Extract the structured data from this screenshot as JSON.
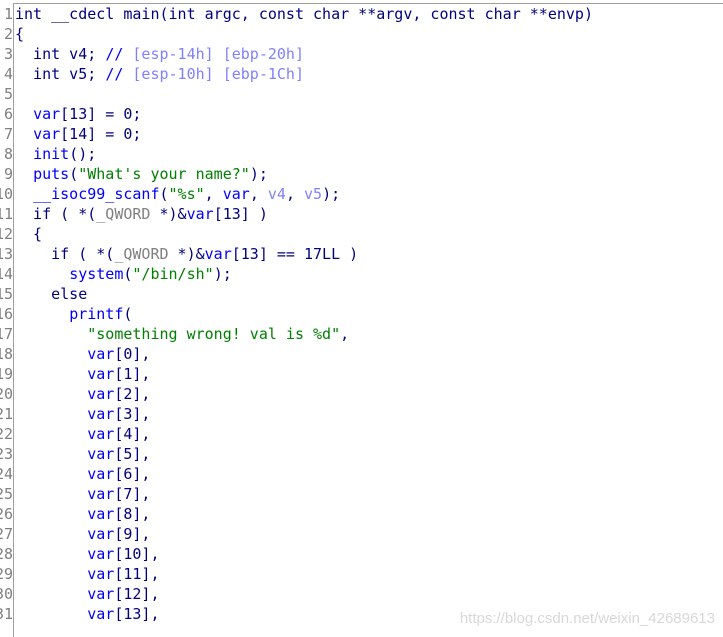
{
  "line_numbers": [
    "1",
    "2",
    "3",
    "4",
    "5",
    "6",
    "7",
    "8",
    "9",
    "10",
    "11",
    "12",
    "13",
    "14",
    "15",
    "16",
    "17",
    "18",
    "19",
    "20",
    "21",
    "22",
    "23",
    "24",
    "25",
    "26",
    "27",
    "28",
    "29",
    "30",
    "31"
  ],
  "lines": [
    [
      [
        "int __cdecl main(int argc, const char **argv, const char **envp)",
        "kw"
      ]
    ],
    [
      [
        "{",
        "kw"
      ]
    ],
    [
      [
        "  int v4; ",
        "kw"
      ],
      [
        "// ",
        "cm"
      ],
      [
        "[esp-14h] [ebp-20h]",
        "cv"
      ]
    ],
    [
      [
        "  int v5; ",
        "kw"
      ],
      [
        "// ",
        "cm"
      ],
      [
        "[esp-10h] [ebp-1Ch]",
        "cv"
      ]
    ],
    [],
    [
      [
        "  ",
        "kw"
      ],
      [
        "var",
        "id"
      ],
      [
        "[13] = 0;",
        "kw"
      ]
    ],
    [
      [
        "  ",
        "kw"
      ],
      [
        "var",
        "id"
      ],
      [
        "[14] = 0;",
        "kw"
      ]
    ],
    [
      [
        "  ",
        "kw"
      ],
      [
        "init",
        "id"
      ],
      [
        "();",
        "kw"
      ]
    ],
    [
      [
        "  ",
        "kw"
      ],
      [
        "puts",
        "id"
      ],
      [
        "(",
        "kw"
      ],
      [
        "\"What's your name?\"",
        "str"
      ],
      [
        ");",
        "kw"
      ]
    ],
    [
      [
        "  ",
        "kw"
      ],
      [
        "__isoc99_scanf",
        "id"
      ],
      [
        "(",
        "kw"
      ],
      [
        "\"%s\"",
        "str"
      ],
      [
        ", ",
        "kw"
      ],
      [
        "var",
        "id"
      ],
      [
        ", ",
        "kw"
      ],
      [
        "v4",
        "cv"
      ],
      [
        ", ",
        "kw"
      ],
      [
        "v5",
        "cv"
      ],
      [
        ");",
        "kw"
      ]
    ],
    [
      [
        "  if ( *(",
        "kw"
      ],
      [
        "_QWORD",
        "ty"
      ],
      [
        " *)&",
        "kw"
      ],
      [
        "var",
        "id"
      ],
      [
        "[13] )",
        "kw"
      ]
    ],
    [
      [
        "  {",
        "kw"
      ]
    ],
    [
      [
        "    if ( *(",
        "kw"
      ],
      [
        "_QWORD",
        "ty"
      ],
      [
        " *)&",
        "kw"
      ],
      [
        "var",
        "id"
      ],
      [
        "[13] == 17LL )",
        "kw"
      ]
    ],
    [
      [
        "      ",
        "kw"
      ],
      [
        "system",
        "id"
      ],
      [
        "(",
        "kw"
      ],
      [
        "\"/bin/sh\"",
        "str"
      ],
      [
        ");",
        "kw"
      ]
    ],
    [
      [
        "    else",
        "kw"
      ]
    ],
    [
      [
        "      ",
        "kw"
      ],
      [
        "printf",
        "id"
      ],
      [
        "(",
        "kw"
      ]
    ],
    [
      [
        "        ",
        "kw"
      ],
      [
        "\"something wrong! val is %d\"",
        "str"
      ],
      [
        ",",
        "kw"
      ]
    ],
    [
      [
        "        ",
        "kw"
      ],
      [
        "var",
        "id"
      ],
      [
        "[0],",
        "kw"
      ]
    ],
    [
      [
        "        ",
        "kw"
      ],
      [
        "var",
        "id"
      ],
      [
        "[1],",
        "kw"
      ]
    ],
    [
      [
        "        ",
        "kw"
      ],
      [
        "var",
        "id"
      ],
      [
        "[2],",
        "kw"
      ]
    ],
    [
      [
        "        ",
        "kw"
      ],
      [
        "var",
        "id"
      ],
      [
        "[3],",
        "kw"
      ]
    ],
    [
      [
        "        ",
        "kw"
      ],
      [
        "var",
        "id"
      ],
      [
        "[4],",
        "kw"
      ]
    ],
    [
      [
        "        ",
        "kw"
      ],
      [
        "var",
        "id"
      ],
      [
        "[5],",
        "kw"
      ]
    ],
    [
      [
        "        ",
        "kw"
      ],
      [
        "var",
        "id"
      ],
      [
        "[6],",
        "kw"
      ]
    ],
    [
      [
        "        ",
        "kw"
      ],
      [
        "var",
        "id"
      ],
      [
        "[7],",
        "kw"
      ]
    ],
    [
      [
        "        ",
        "kw"
      ],
      [
        "var",
        "id"
      ],
      [
        "[8],",
        "kw"
      ]
    ],
    [
      [
        "        ",
        "kw"
      ],
      [
        "var",
        "id"
      ],
      [
        "[9],",
        "kw"
      ]
    ],
    [
      [
        "        ",
        "kw"
      ],
      [
        "var",
        "id"
      ],
      [
        "[10],",
        "kw"
      ]
    ],
    [
      [
        "        ",
        "kw"
      ],
      [
        "var",
        "id"
      ],
      [
        "[11],",
        "kw"
      ]
    ],
    [
      [
        "        ",
        "kw"
      ],
      [
        "var",
        "id"
      ],
      [
        "[12],",
        "kw"
      ]
    ],
    [
      [
        "        ",
        "kw"
      ],
      [
        "var",
        "id"
      ],
      [
        "[13],",
        "kw"
      ]
    ]
  ],
  "watermark": "https://blog.csdn.net/weixin_42689613"
}
